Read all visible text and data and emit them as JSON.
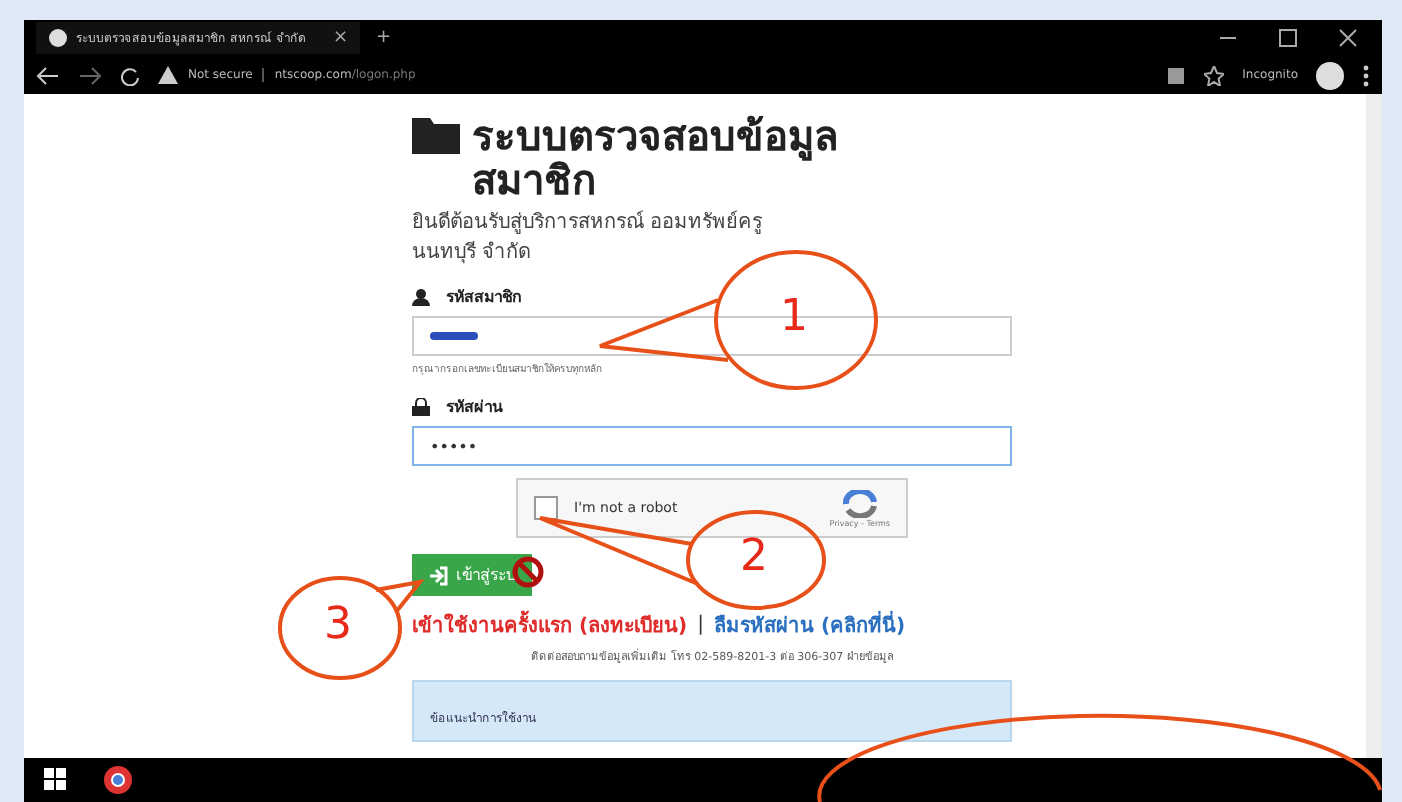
{
  "browser": {
    "tab_title": "ระบบตรวจสอบข้อมูลสมาชิก สหกรณ์ จำกัด",
    "tab_close": "×",
    "new_tab": "+",
    "security": "Not secure",
    "url_host": "ntscoop.com",
    "url_path": "/logon.php",
    "incognito": "Incognito"
  },
  "page": {
    "title": "ระบบตรวจสอบข้อมูลสมาชิก",
    "subtitle": "ยินดีต้อนรับสู่บริการสหกรณ์ ออมทรัพย์ครู นนทบุรี จำกัด",
    "fields": [
      {
        "label": "รหัสสมาชิก",
        "masked": false,
        "focused": false,
        "hint": "กรุณากรอกเลขทะเบียนสมาชิกให้ครบทุกหลัก"
      },
      {
        "label": "รหัสผ่าน",
        "value": "•••••",
        "masked": true,
        "focused": true
      }
    ],
    "captcha": {
      "label": "I'm not a robot",
      "checked": false,
      "footer": "Privacy - Terms"
    },
    "login_button": "เข้าสู่ระบ",
    "links": [
      {
        "text": "เข้าใช้งานครั้งแรก (ลงทะเบียน)",
        "kind": "register"
      },
      {
        "text": "ลืมรหัสผ่าน (คลิกที่นี่)",
        "kind": "forgot"
      }
    ],
    "link_separator": "|",
    "contact_note": "ติดต่อสอบถามข้อมูลเพิ่มเติม โทร 02-589-8201-3 ต่อ 306-307 ฝ่ายข้อมูล",
    "notice_heading": "ข้อแนะนำการใช้งาน"
  },
  "callouts": [
    {
      "number": "1"
    },
    {
      "number": "2"
    },
    {
      "number": "3"
    }
  ]
}
